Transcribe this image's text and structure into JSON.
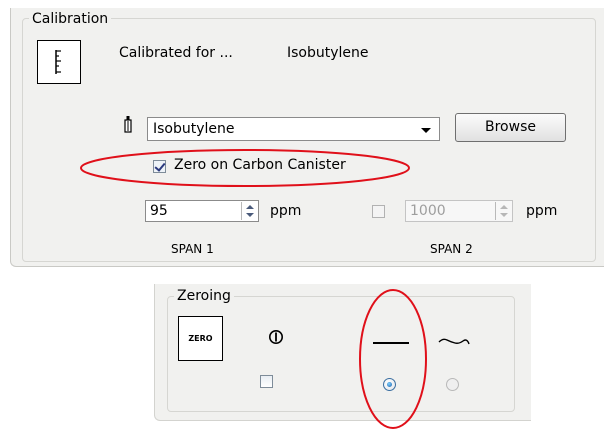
{
  "calibration": {
    "group_title": "Calibration",
    "calibrated_for_label": "Calibrated for ...",
    "calibrated_gas": "Isobutylene",
    "gas_select_value": "Isobutylene",
    "browse_label": "Browse",
    "zero_on_carbon_label": "Zero on Carbon Canister",
    "zero_on_carbon_checked": true,
    "span1": {
      "value": "95",
      "unit": "ppm",
      "label": "SPAN 1"
    },
    "span2": {
      "value": "1000",
      "unit": "ppm",
      "label": "SPAN 2",
      "enabled": false,
      "checked": false
    }
  },
  "zeroing": {
    "group_title": "Zeroing",
    "icon_text": "ZERO",
    "checkbox_checked": false,
    "options": [
      {
        "icon": "flat-line-icon",
        "selected": true
      },
      {
        "icon": "wave-line-icon",
        "selected": false,
        "enabled": false
      }
    ]
  },
  "icons": [
    "calibration-ruler-icon",
    "gas-bottle-icon",
    "power-icon",
    "chevron-down-icon"
  ],
  "colors": {
    "annotation_red": "#e0101a",
    "panel_bg": "#f1f1ef",
    "radio_selected": "#1a5ea8"
  }
}
